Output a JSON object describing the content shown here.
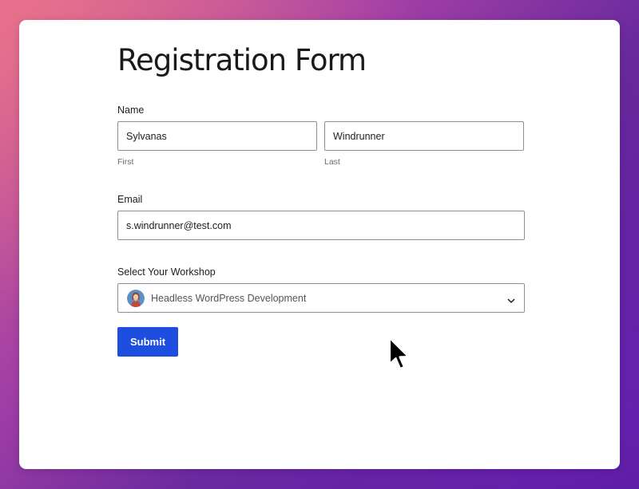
{
  "form": {
    "title": "Registration Form",
    "name": {
      "label": "Name",
      "first": {
        "value": "Sylvanas",
        "sublabel": "First"
      },
      "last": {
        "value": "Windrunner",
        "sublabel": "Last"
      }
    },
    "email": {
      "label": "Email",
      "value": "s.windrunner@test.com"
    },
    "workshop": {
      "label": "Select Your Workshop",
      "selected": "Headless WordPress Development",
      "avatar_icon": "presenter-avatar",
      "arrow_icon": "chevron-down-icon"
    },
    "submit_label": "Submit"
  },
  "colors": {
    "accent": "#1d4ee0",
    "border": "#8c8f94",
    "card": "#ffffff",
    "background_start": "#e06a8a",
    "background_end": "#4d1690"
  },
  "cursor_icon": "mouse-pointer-icon"
}
